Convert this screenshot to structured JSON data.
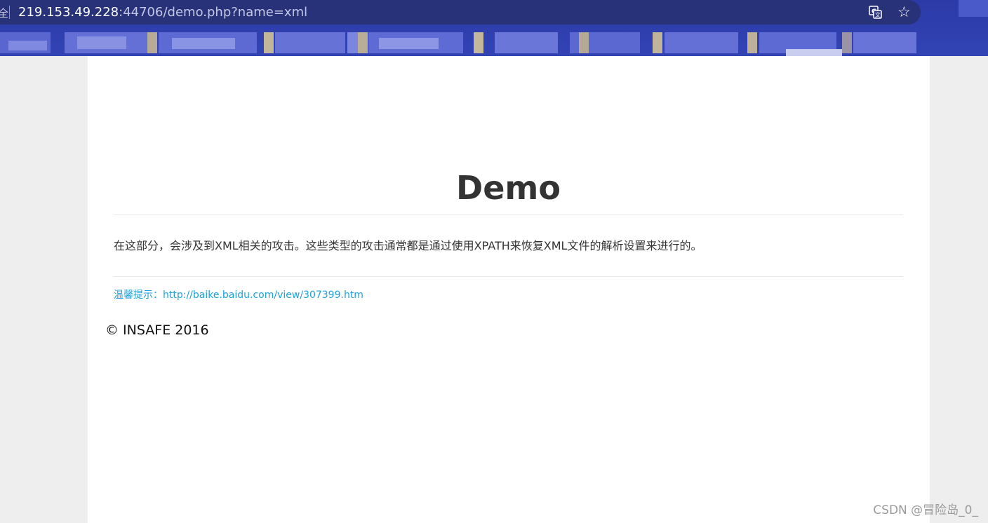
{
  "browser": {
    "url_host": "219.153.49.228",
    "url_rest": ":44706/demo.php?name=xml",
    "translate_icon": "translate-icon",
    "bookmark_icon": "star-icon",
    "lock_icon": "security-indicator-icon"
  },
  "page": {
    "title": "Demo",
    "description": "在这部分，会涉及到XML相关的攻击。这些类型的攻击通常都是通过使用XPATH来恢复XML文件的解析设置来进行的。",
    "hint_label": "温馨提示：",
    "hint_link": "http://baike.baidu.com/view/307399.htm",
    "footer": "© INSAFE 2016"
  },
  "watermark": "CSDN @冒险岛_0_",
  "colors": {
    "chrome_bar": "#3243b4",
    "address_bar": "#283279",
    "page_background": "#eeeeee",
    "content_background": "#ffffff",
    "heading_text": "#333333",
    "link": "#1ea1dc"
  }
}
